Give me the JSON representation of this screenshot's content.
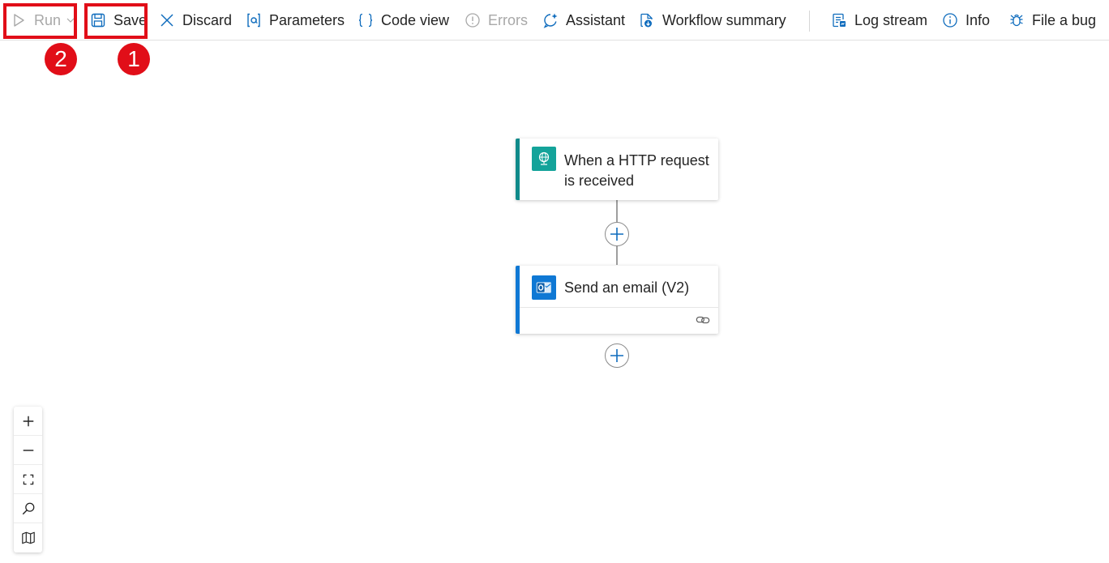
{
  "toolbar": {
    "run_label": "Run",
    "save_label": "Save",
    "discard_label": "Discard",
    "parameters_label": "Parameters",
    "code_view_label": "Code view",
    "errors_label": "Errors",
    "assistant_label": "Assistant",
    "workflow_summary_label": "Workflow summary",
    "log_stream_label": "Log stream",
    "info_label": "Info",
    "file_bug_label": "File a bug",
    "icons": [
      "play-icon",
      "chevron-down-icon",
      "save-icon",
      "close-icon",
      "parameters-icon",
      "braces-icon",
      "error-icon",
      "assistant-icon",
      "workflow-summary-icon",
      "log-stream-icon",
      "info-icon",
      "bug-icon"
    ]
  },
  "annotations": {
    "badge_save": "1",
    "badge_run": "2",
    "highlight_color": "#e10e18"
  },
  "workflow": {
    "trigger": {
      "title_line1": "When a HTTP request",
      "title_line2": "is received",
      "accent_color": "#0f8a8a",
      "icon": "http-globe-icon"
    },
    "action": {
      "title": "Send an email (V2)",
      "accent_color": "#0f78d4",
      "icon": "outlook-icon",
      "footer_icon": "link-icon"
    }
  },
  "zoom_controls": {
    "icons": [
      "zoom-in-icon",
      "zoom-out-icon",
      "fit-view-icon",
      "search-icon",
      "minimap-icon"
    ]
  }
}
